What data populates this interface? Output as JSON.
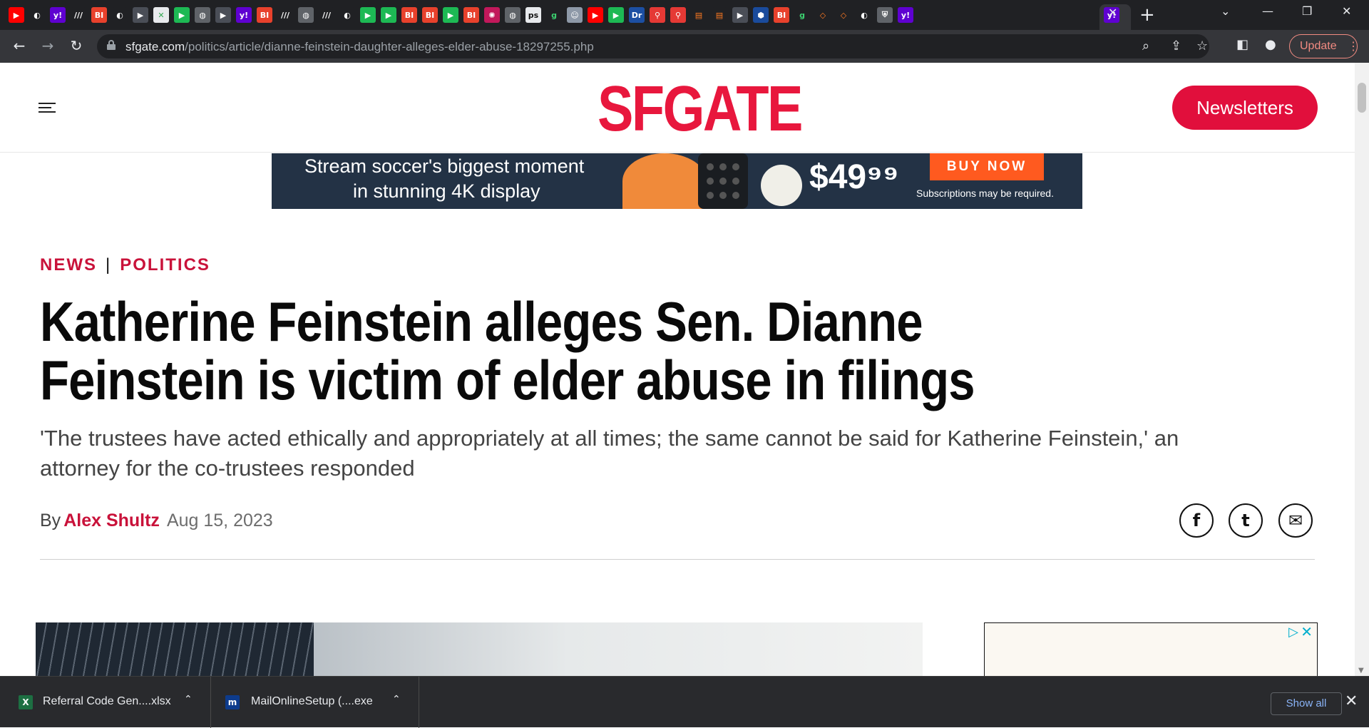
{
  "browser": {
    "tab_favicons": [
      "yt",
      "gd",
      "y",
      "lh",
      "bi",
      "gd",
      "dp",
      "gx",
      "gp",
      "gl",
      "dp",
      "y",
      "bi",
      "lh",
      "gl",
      "lh",
      "gd",
      "gp",
      "gp",
      "bi",
      "bi",
      "gp",
      "bi",
      "rd",
      "gl",
      "ps",
      "g",
      "cm",
      "yt",
      "gp",
      "dr",
      "ap",
      "ap",
      "ab",
      "ab",
      "dp",
      "hx",
      "bi",
      "g",
      "br",
      "br",
      "gd",
      "ch",
      "y"
    ],
    "active_tab_favicon": "y",
    "url_host": "sfgate.com",
    "url_path": "/politics/article/dianne-feinstein-daughter-alleges-elder-abuse-18297255.php",
    "update_label": "Update"
  },
  "site": {
    "logo": "SFGATE",
    "newsletters_label": "Newsletters"
  },
  "ad": {
    "line1": "Stream soccer's biggest moment",
    "line2": "in stunning 4K display",
    "price": "$49⁹⁹",
    "buy_label": "BUY NOW",
    "fine_print": "Subscriptions may be required."
  },
  "article": {
    "section": "NEWS",
    "subsection": "POLITICS",
    "headline": "Katherine Feinstein alleges Sen. Dianne Feinstein is victim of elder abuse in filings",
    "subhead": "'The trustees have acted ethically and appropriately at all times; the same cannot be said for Katherine Feinstein,' an attorney for the co-trustees responded",
    "by_label": "By",
    "author": "Alex Shultz",
    "date": "Aug 15, 2023"
  },
  "share": {
    "facebook": "f",
    "twitter": "t",
    "email": "✉"
  },
  "downloads": {
    "items": [
      {
        "name": "Referral Code Gen....xlsx",
        "icon": "excel-icon"
      },
      {
        "name": "MailOnlineSetup (....exe",
        "icon": "mailonline-icon"
      }
    ],
    "show_all_label": "Show all"
  },
  "colors": {
    "brand": "#e10f3c",
    "section": "#c9123a",
    "chrome_dark": "#202124",
    "chrome_toolbar": "#35363a"
  }
}
